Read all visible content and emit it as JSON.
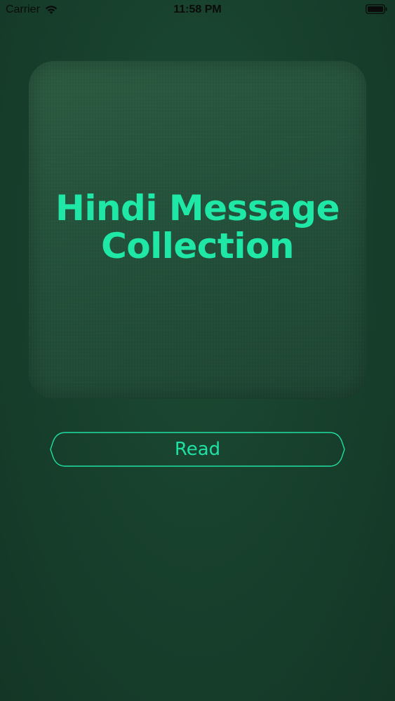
{
  "status_bar": {
    "carrier": "Carrier",
    "time": "11:58 PM",
    "icons": [
      "wifi-icon",
      "battery-icon"
    ]
  },
  "cover": {
    "title_line1": "Hindi Message",
    "title_line2": "Collection"
  },
  "actions": {
    "read_label": "Read"
  },
  "colors": {
    "background": "#173f2c",
    "card": "#23503a",
    "accent": "#1fe8a6"
  }
}
